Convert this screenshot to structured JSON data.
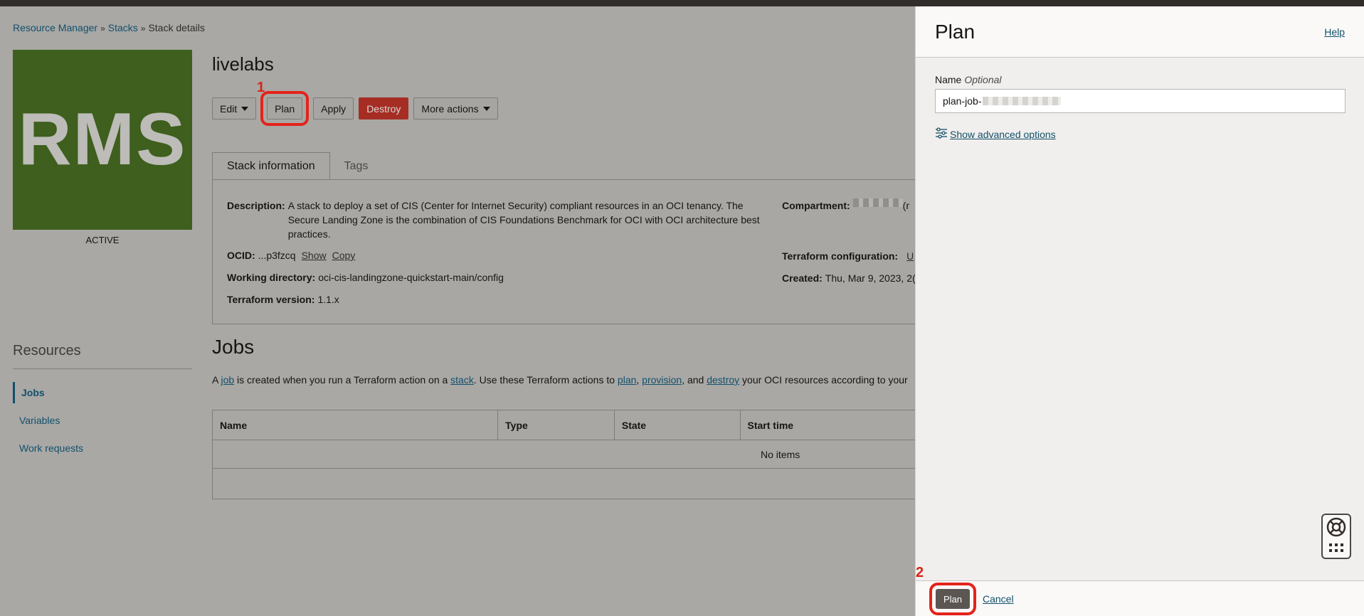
{
  "breadcrumb": [
    "Resource Manager",
    "Stacks",
    "Stack details"
  ],
  "stack": {
    "logo_text": "RMS",
    "status": "ACTIVE",
    "name": "livelabs"
  },
  "actions": {
    "edit": "Edit",
    "plan": "Plan",
    "apply": "Apply",
    "destroy": "Destroy",
    "more": "More actions"
  },
  "markers": {
    "first": "1",
    "second": "2"
  },
  "tabs": [
    "Stack information",
    "Tags"
  ],
  "info": {
    "description_label": "Description:",
    "description": "A stack to deploy a set of CIS (Center for Internet Security) compliant resources in an OCI tenancy. The Secure Landing Zone is the combination of CIS Foundations Benchmark for OCI with OCI architecture best practices.",
    "ocid_label": "OCID:",
    "ocid": "...p3fzcq",
    "show": "Show",
    "copy": "Copy",
    "workdir_label": "Working directory:",
    "workdir": "oci-cis-landingzone-quickstart-main/config",
    "tfversion_label": "Terraform version:",
    "tfversion": "1.1.x",
    "compartment_label": "Compartment:",
    "compartment_suffix": "(r",
    "tfconfig_label": "Terraform configuration:",
    "tfconfig_value": "U",
    "created_label": "Created:",
    "created": "Thu, Mar 9, 2023, 2("
  },
  "resources": {
    "title": "Resources",
    "items": [
      "Jobs",
      "Variables",
      "Work requests"
    ]
  },
  "jobs": {
    "title": "Jobs",
    "desc": {
      "t1": "A ",
      "job": "job",
      "t2": " is created when you run a Terraform action on a ",
      "stack": "stack",
      "t3": ". Use these Terraform actions to ",
      "plan": "plan",
      "t4": ", ",
      "provision": "provision",
      "t5": ", and ",
      "destroy": "destroy",
      "t6": " your OCI resources according to your"
    },
    "columns": [
      "Name",
      "Type",
      "State",
      "Start time"
    ],
    "empty": "No items"
  },
  "drawer": {
    "title": "Plan",
    "help": "Help",
    "name_label": "Name",
    "optional": "Optional",
    "name_value": "plan-job-",
    "advanced": "Show advanced options",
    "submit": "Plan",
    "cancel": "Cancel"
  },
  "colors": {
    "accent_red": "#e4231a",
    "link": "#12506b",
    "destroy": "#a62d24",
    "logo_bg": "#3e5f1d"
  }
}
